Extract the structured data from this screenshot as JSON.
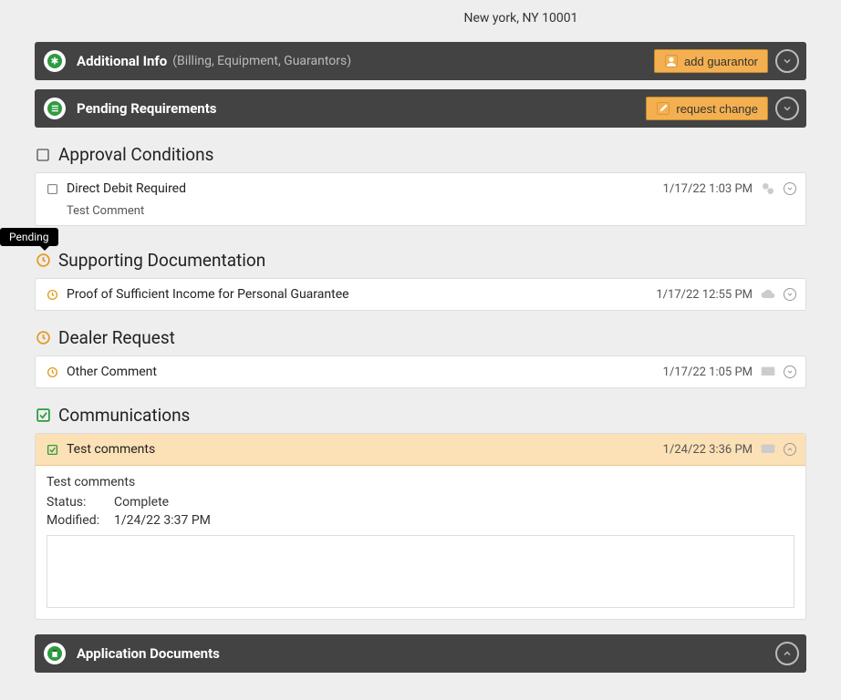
{
  "address": "New york, NY 10001",
  "panels": {
    "additional": {
      "title": "Additional Info",
      "subtitle": "(Billing, Equipment, Guarantors)",
      "button": "add guarantor"
    },
    "pending": {
      "title": "Pending Requirements",
      "button": "request change"
    },
    "docs": {
      "title": "Application Documents"
    }
  },
  "tooltip": "Pending",
  "sections": {
    "approval": {
      "title": "Approval Conditions",
      "item": {
        "title": "Direct Debit Required",
        "comment": "Test Comment",
        "time": "1/17/22 1:03 PM"
      }
    },
    "supporting": {
      "title": "Supporting Documentation",
      "item": {
        "title": "Proof of Sufficient Income for Personal Guarantee",
        "time": "1/17/22 12:55 PM"
      }
    },
    "dealer": {
      "title": "Dealer Request",
      "item": {
        "title": "Other Comment",
        "time": "1/17/22 1:05 PM"
      }
    },
    "comms": {
      "title": "Communications",
      "item": {
        "title": "Test comments",
        "time": "1/24/22 3:36 PM",
        "detail_title": "Test comments",
        "status_label": "Status:",
        "status_value": "Complete",
        "modified_label": "Modified:",
        "modified_value": "1/24/22 3:37 PM"
      }
    }
  }
}
